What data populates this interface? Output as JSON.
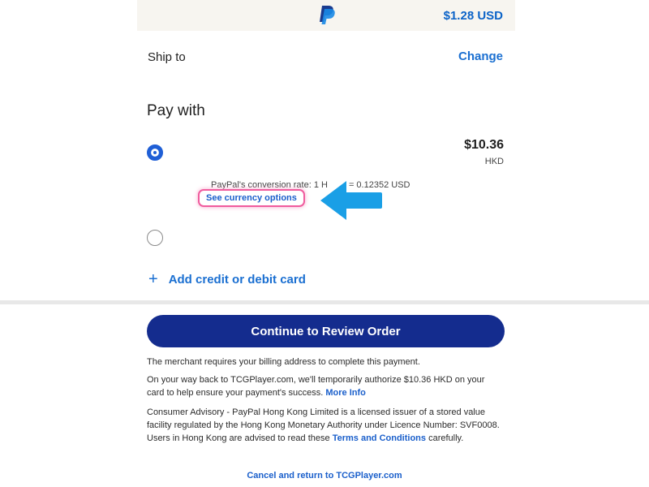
{
  "header": {
    "logo_icon": "paypal-logo-icon",
    "amount": "$1.28 USD"
  },
  "shipping": {
    "label": "Ship to",
    "change_label": "Change"
  },
  "payment": {
    "heading": "Pay with",
    "option1": {
      "selected": true,
      "amount": "$10.36",
      "currency": "HKD",
      "conversion_rate": "PayPal's conversion rate: 1 H",
      "conversion_rate_tail": "= 0.12352 USD",
      "currency_options_label": "See currency options"
    },
    "option2": {
      "selected": false
    },
    "add_card_label": "Add credit or debit card"
  },
  "annotation": {
    "arrow_icon": "left-arrow-icon",
    "arrow_color": "#1a9fe6",
    "highlight_color": "#f05c9e"
  },
  "footer": {
    "continue_label": "Continue to Review Order",
    "billing_notice": "The merchant requires your billing address to complete this payment.",
    "authorize_notice": "On your way back to TCGPlayer.com, we'll temporarily authorize $10.36 HKD on your card to help ensure your payment's success.",
    "more_info_label": "More Info",
    "advisory_text": "Consumer Advisory - PayPal Hong Kong Limited is a licensed issuer of a stored value facility regulated by the Hong Kong Monetary Authority under Licence Number: SVF0008. Users in Hong Kong are advised to read these",
    "terms_label": "Terms and Conditions",
    "advisory_tail": "carefully.",
    "cancel_label": "Cancel and return to TCGPlayer.com"
  },
  "colors": {
    "brand_blue": "#142c8e",
    "link_blue": "#1a6fd1"
  }
}
